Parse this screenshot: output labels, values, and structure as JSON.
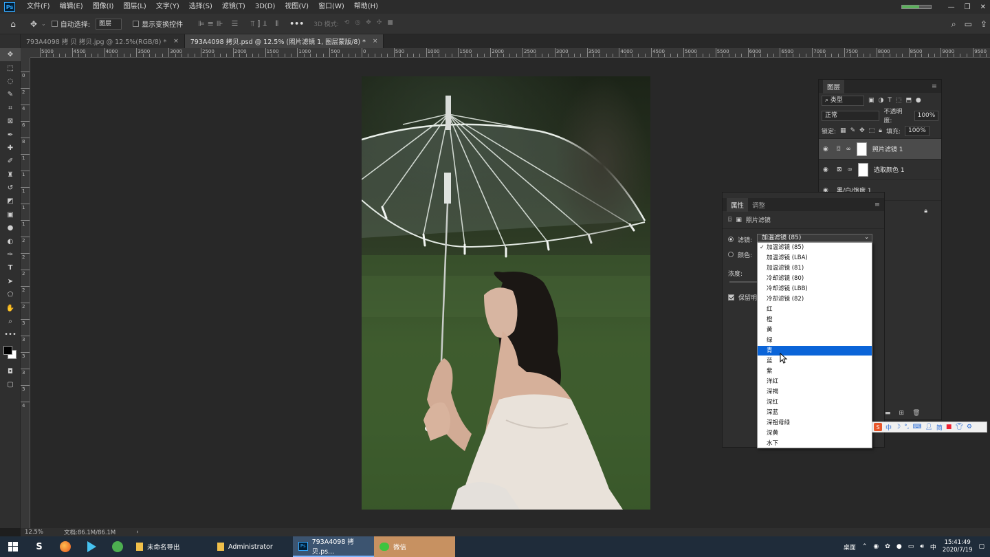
{
  "menubar": {
    "items": [
      "文件(F)",
      "编辑(E)",
      "图像(I)",
      "图层(L)",
      "文字(Y)",
      "选择(S)",
      "滤镜(T)",
      "3D(D)",
      "视图(V)",
      "窗口(W)",
      "帮助(H)"
    ]
  },
  "options": {
    "auto_select_label": "自动选择:",
    "auto_select_value": "图层",
    "show_transform_label": "显示变换控件",
    "mode_3d_label": "3D 模式:"
  },
  "tabs": [
    {
      "label": "793A4098 拷 贝 拷贝.jpg @ 12.5%(RGB/8) *",
      "close": "×"
    },
    {
      "label": "793A4098 拷贝.psd @ 12.5% (照片滤镜 1, 图层蒙版/8) *",
      "close": "×"
    }
  ],
  "ruler": {
    "h_labels": [
      "5000",
      "4500",
      "4000",
      "3500",
      "3000",
      "2500",
      "2000",
      "1500",
      "1000",
      "500",
      "0",
      "500",
      "1000",
      "1500",
      "2000",
      "2500",
      "3000",
      "3500",
      "4000",
      "4500",
      "5000",
      "5500",
      "6000",
      "6500",
      "7000",
      "7500",
      "8000",
      "8500",
      "9000",
      "9500"
    ],
    "v_labels": [
      "0",
      "2",
      "4",
      "6",
      "8",
      "1",
      "1",
      "1",
      "1",
      "1",
      "2",
      "2",
      "2",
      "2",
      "2",
      "3",
      "3",
      "3",
      "3",
      "3",
      "4"
    ]
  },
  "layers_panel": {
    "title": "图层",
    "filter_label": "类型",
    "blend_mode": "正常",
    "opacity_label": "不透明度:",
    "opacity_value": "100%",
    "lock_label": "锁定:",
    "fill_label": "填充:",
    "fill_value": "100%",
    "layers": [
      {
        "name": "照片滤镜 1",
        "active": true
      },
      {
        "name": "选取颜色 1",
        "active": false
      },
      {
        "name": "黑/白/饱度 1",
        "active": false
      }
    ]
  },
  "properties_panel": {
    "tab_properties": "属性",
    "tab_adjust": "调整",
    "title": "照片滤镜",
    "filter_label": "滤镜:",
    "color_label": "颜色:",
    "density_label": "浓度:",
    "preserve_label": "保留明度",
    "filter_selected": "加温滤镜 (85)"
  },
  "dropdown": {
    "items": [
      "加温滤镜 (85)",
      "加温滤镜 (LBA)",
      "加温滤镜 (81)",
      "冷却滤镜 (80)",
      "冷却滤镜 (LBB)",
      "冷却滤镜 (82)",
      "红",
      "橙",
      "黄",
      "绿",
      "青",
      "蓝",
      "紫",
      "洋红",
      "深褐",
      "深红",
      "深蓝",
      "深祖母绿",
      "深黄",
      "水下"
    ],
    "checked_index": 0,
    "highlighted_index": 10
  },
  "ime": {
    "items": [
      "中",
      "简"
    ]
  },
  "status": {
    "zoom": "12.5%",
    "doc": "文档:86.1M/86.1M"
  },
  "taskbar": {
    "apps": [
      {
        "label": "未命名导出"
      },
      {
        "label": "Administrator"
      },
      {
        "label": "793A4098 拷贝.ps..."
      },
      {
        "label": "微信"
      }
    ],
    "desktop_label": "桌面",
    "input_label": "中",
    "time": "15:41:49",
    "date": "2020/7/19"
  },
  "colors": {
    "accent": "#0a64d8",
    "panel_bg": "#2f2f2f",
    "taskbar": "#1f2c3a"
  }
}
